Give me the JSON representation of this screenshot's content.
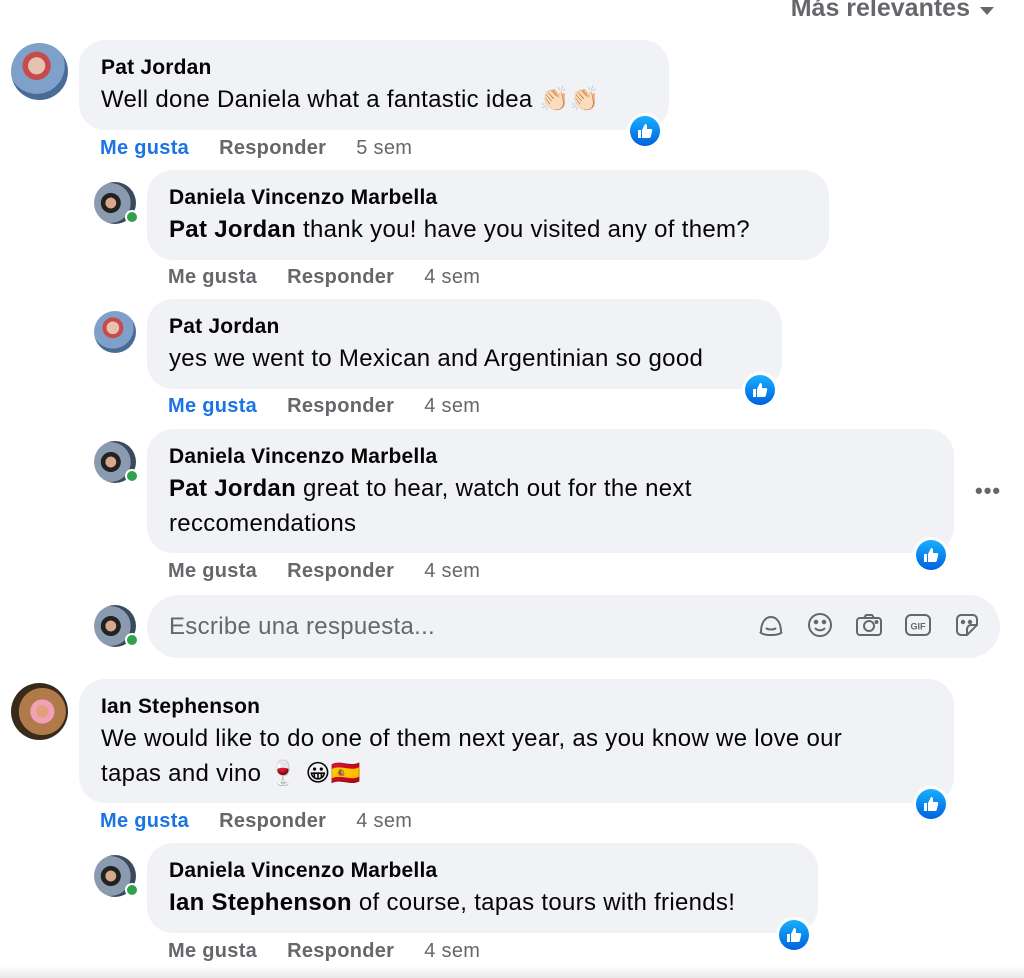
{
  "sort_label": "Más relevantes",
  "actions": {
    "like": "Me gusta",
    "reply": "Responder"
  },
  "reply_placeholder": "Escribe una respuesta...",
  "comments": [
    {
      "author": "Pat Jordan",
      "text": "Well done Daniela what a fantastic idea 👏🏻👏🏻",
      "time": "5 sem",
      "liked": true
    },
    {
      "author": "Daniela Vincenzo Marbella",
      "mention": "Pat Jordan",
      "text": " thank you! have you visited any of them?",
      "time": "4 sem",
      "liked": false
    },
    {
      "author": "Pat Jordan",
      "text": "yes we went to Mexican and Argentinian so good",
      "time": "4 sem",
      "liked": true
    },
    {
      "author": "Daniela Vincenzo Marbella",
      "mention": "Pat Jordan",
      "text": " great to hear, watch out for the next",
      "text2": "reccomendations",
      "time": "4 sem",
      "liked": false
    },
    {
      "author": "Ian Stephenson",
      "text": "We would like to do one of them next year, as you know we love our",
      "text2": "tapas and vino 🍷 😀🇪🇸",
      "time": "4 sem",
      "liked": true
    },
    {
      "author": "Daniela Vincenzo Marbella",
      "mention": "Ian Stephenson",
      "text": " of course, tapas tours with friends!",
      "time": "4 sem",
      "liked": false
    }
  ],
  "colors": {
    "bubble": "#f0f2f5",
    "accent": "#1b74e4",
    "muted": "#65676b",
    "online": "#31a24c"
  },
  "icons": [
    "like-thumb-icon",
    "more-options-icon",
    "avatar-sticker-icon",
    "emoji-icon",
    "camera-icon",
    "gif-icon",
    "sticker-icon",
    "caret-down-icon"
  ]
}
